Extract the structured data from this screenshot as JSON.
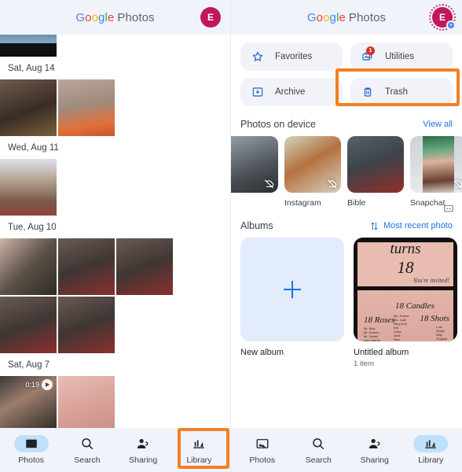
{
  "header": {
    "brand_google": "Google",
    "brand_word": "Photos",
    "avatar_initial": "E"
  },
  "left_pane": {
    "sections": [
      {
        "date": "Sat, Aug 14",
        "tiles": [
          {
            "name": "photo-church",
            "art": "ph-church"
          },
          {
            "name": "photo-girl-peace-sign",
            "art": "ph-girl-peace"
          }
        ]
      },
      {
        "date": "Wed, Aug 11",
        "tiles": [
          {
            "name": "photo-selfie",
            "art": "ph-selfie"
          }
        ]
      },
      {
        "date": "Tue, Aug 10",
        "tiles": [
          {
            "name": "photo-collage",
            "art": "ph-collage1"
          },
          {
            "name": "photo-group-1",
            "art": "ph-group"
          },
          {
            "name": "photo-group-2",
            "art": "ph-group"
          },
          {
            "name": "photo-group-3",
            "art": "ph-group"
          },
          {
            "name": "photo-group-4",
            "art": "ph-group"
          }
        ]
      },
      {
        "date": "Sat, Aug 7",
        "tiles": [
          {
            "name": "video-couple",
            "art": "ph-vid",
            "duration": "0:19"
          },
          {
            "name": "photo-invite-pink",
            "art": "ph-pink"
          }
        ]
      }
    ],
    "top_partial_photo": "photo-mountain-sunset"
  },
  "right_pane": {
    "chips": [
      {
        "label": "Favorites",
        "icon": "star-icon",
        "badge": null,
        "highlighted": false
      },
      {
        "label": "Utilities",
        "icon": "utilities-icon",
        "badge": "1",
        "highlighted": false
      },
      {
        "label": "Archive",
        "icon": "archive-icon",
        "badge": null,
        "highlighted": false
      },
      {
        "label": "Trash",
        "icon": "trash-icon",
        "badge": null,
        "highlighted": true
      }
    ],
    "device_section": {
      "title": "Photos on device",
      "action": "View all",
      "folders": [
        {
          "label": "",
          "art": "ph-edge",
          "backup_off": true
        },
        {
          "label": "Instagram",
          "art": "ph-food",
          "backup_off": true
        },
        {
          "label": "Bible",
          "art": "ph-bible",
          "backup_off": false
        },
        {
          "label": "Snapchat",
          "art": "ph-snap",
          "backup_off": true
        }
      ]
    },
    "albums_section": {
      "title": "Albums",
      "sort_label": "Most recent photo",
      "items": [
        {
          "title": "New album",
          "subtitle": "",
          "kind": "new"
        },
        {
          "title": "Untitled album",
          "subtitle": "1 item",
          "kind": "album"
        }
      ]
    }
  },
  "invite_art": {
    "line1": "turns",
    "line2": "18",
    "line3": "You're invited!",
    "roses": "18 Roses",
    "candles": "18 Candles",
    "shots": "18 Shots"
  },
  "bottom_nav_left": {
    "items": [
      {
        "label": "Photos",
        "icon": "photos-icon",
        "active": true,
        "highlighted": false
      },
      {
        "label": "Search",
        "icon": "search-icon",
        "active": false,
        "highlighted": false
      },
      {
        "label": "Sharing",
        "icon": "sharing-icon",
        "active": false,
        "highlighted": false
      },
      {
        "label": "Library",
        "icon": "library-icon",
        "active": false,
        "highlighted": true
      }
    ]
  },
  "bottom_nav_right": {
    "items": [
      {
        "label": "Photos",
        "icon": "photos-icon",
        "active": false,
        "highlighted": false
      },
      {
        "label": "Search",
        "icon": "search-icon",
        "active": false,
        "highlighted": false
      },
      {
        "label": "Sharing",
        "icon": "sharing-icon",
        "active": false,
        "highlighted": false
      },
      {
        "label": "Library",
        "icon": "library-icon",
        "active": true,
        "highlighted": false
      }
    ]
  },
  "colors": {
    "accent_blue": "#1a73e8",
    "highlight_orange": "#f28022",
    "badge_red": "#d93025",
    "avatar_pink": "#c2185b",
    "chip_bg": "#f1f3f9",
    "nav_bg": "#f1f3fb"
  }
}
